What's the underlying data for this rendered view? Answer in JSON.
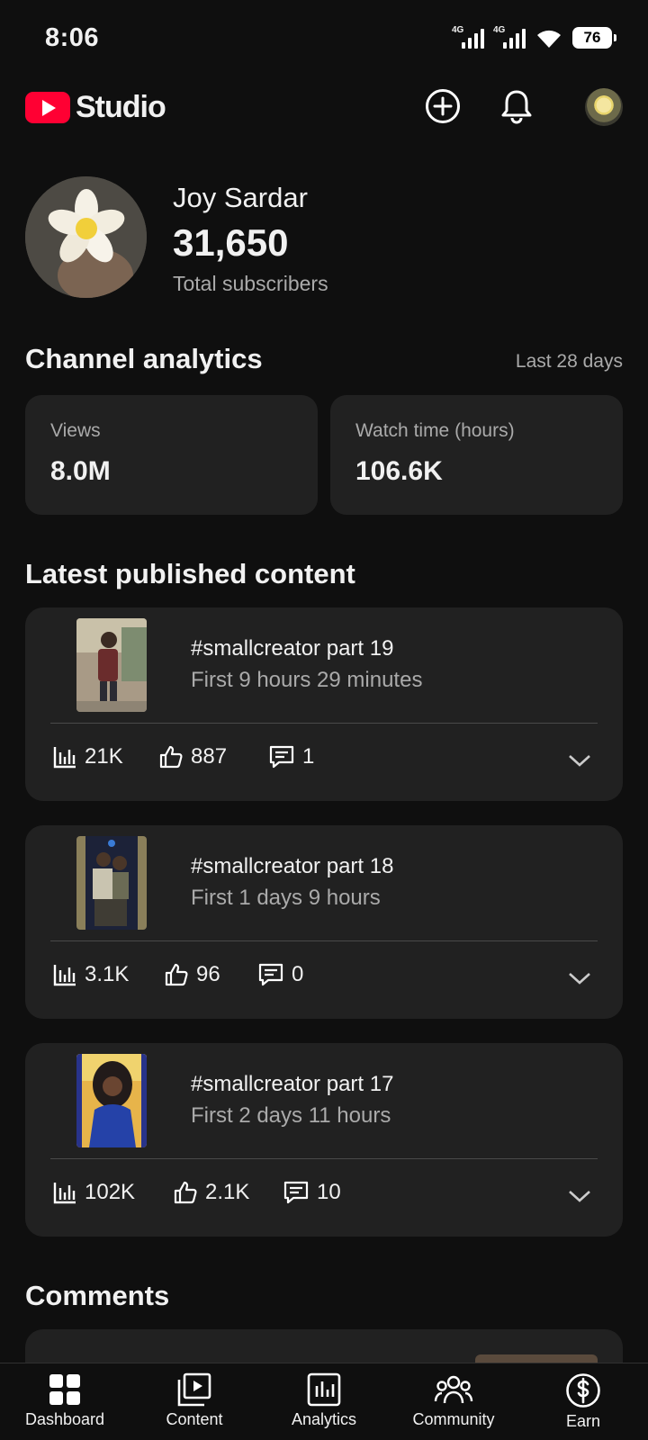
{
  "status_bar": {
    "time": "8:06",
    "signal1_tag": "4G",
    "signal2_tag": "4G",
    "battery": "76"
  },
  "header": {
    "brand": "Studio",
    "icons": [
      "add-circle-icon",
      "bell-icon",
      "account-avatar"
    ]
  },
  "channel": {
    "name": "Joy Sardar",
    "subscribers": "31,650",
    "subscribers_label": "Total subscribers"
  },
  "analytics": {
    "title": "Channel analytics",
    "range": "Last 28 days",
    "cards": [
      {
        "label": "Views",
        "value": "8.0M"
      },
      {
        "label": "Watch time (hours)",
        "value": "106.6K"
      }
    ]
  },
  "latest": {
    "title": "Latest published content",
    "items": [
      {
        "title": "#smallcreator part 19",
        "subtitle": "First 9 hours 29 minutes",
        "views": "21K",
        "likes": "887",
        "comments": "1"
      },
      {
        "title": "#smallcreator part 18",
        "subtitle": "First 1 days 9 hours",
        "views": "3.1K",
        "likes": "96",
        "comments": "0"
      },
      {
        "title": "#smallcreator part 17",
        "subtitle": "First 2 days 11 hours",
        "views": "102K",
        "likes": "2.1K",
        "comments": "10"
      }
    ]
  },
  "comments": {
    "title": "Comments"
  },
  "bottom_nav": {
    "items": [
      {
        "label": "Dashboard",
        "icon": "dashboard-icon"
      },
      {
        "label": "Content",
        "icon": "content-icon"
      },
      {
        "label": "Analytics",
        "icon": "analytics-icon"
      },
      {
        "label": "Community",
        "icon": "community-icon"
      },
      {
        "label": "Earn",
        "icon": "earn-icon"
      }
    ]
  },
  "colors": {
    "background": "#0f0f0f",
    "card": "#212121",
    "brand_red": "#ff0033",
    "secondary_text": "#aaaaaa"
  }
}
